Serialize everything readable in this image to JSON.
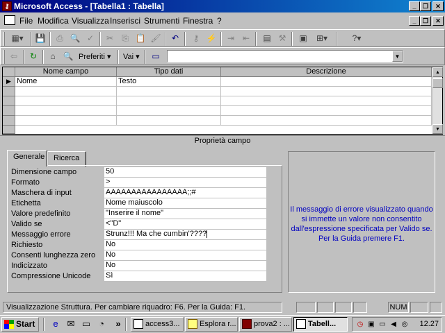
{
  "window": {
    "title": "Microsoft Access - [Tabella1 : Tabella]",
    "app_icon": "key-icon"
  },
  "menu": [
    "File",
    "Modifica",
    "Visualizza",
    "Inserisci",
    "Strumenti",
    "Finestra",
    "?"
  ],
  "web_toolbar": {
    "favorites_label": "Preferiti",
    "go_label": "Vai",
    "address_value": ""
  },
  "grid": {
    "columns": [
      "Nome campo",
      "Tipo dati",
      "Descrizione"
    ],
    "rows": [
      {
        "name": "Nome",
        "type": "Testo",
        "description": ""
      }
    ]
  },
  "properties": {
    "section_title": "Proprietà campo",
    "tabs": [
      "Generale",
      "Ricerca"
    ],
    "active_tab": "Generale",
    "rows": [
      {
        "label": "Dimensione campo",
        "value": "50"
      },
      {
        "label": "Formato",
        "value": ">"
      },
      {
        "label": "Maschera di input",
        "value": "AAAAAAAAAAAAAAAA;;#"
      },
      {
        "label": "Etichetta",
        "value": "Nome maiuscolo"
      },
      {
        "label": "Valore predefinito",
        "value": "\"Inserire il nome\""
      },
      {
        "label": "Valido se",
        "value": "<\"D\""
      },
      {
        "label": "Messaggio errore",
        "value": "Strunz!!! Ma che cumbin'????"
      },
      {
        "label": "Richiesto",
        "value": "No"
      },
      {
        "label": "Consenti lunghezza zero",
        "value": "No"
      },
      {
        "label": "Indicizzato",
        "value": "No"
      },
      {
        "label": "Compressione Unicode",
        "value": "Sì"
      }
    ],
    "help_text_lines": [
      "Il messaggio di errore visualizzato quando",
      "si immette un valore non consentito",
      "dall'espressione specificata per Valido se.",
      "Per la Guida premere F1."
    ]
  },
  "status": {
    "text": "Visualizzazione Struttura. Per cambiare riquadro: F6. Per la Guida: F1.",
    "num": "NUM"
  },
  "taskbar": {
    "start_label": "Start",
    "tasks": [
      {
        "label": "access3...",
        "active": false
      },
      {
        "label": "Esplora r...",
        "active": false
      },
      {
        "label": "prova2 : ...",
        "active": false
      },
      {
        "label": "Tabell...",
        "active": true
      }
    ],
    "clock": "12.27"
  },
  "colors": {
    "titlebar": "#000080",
    "help_text": "#0000c0",
    "face": "#c0c0c0"
  }
}
